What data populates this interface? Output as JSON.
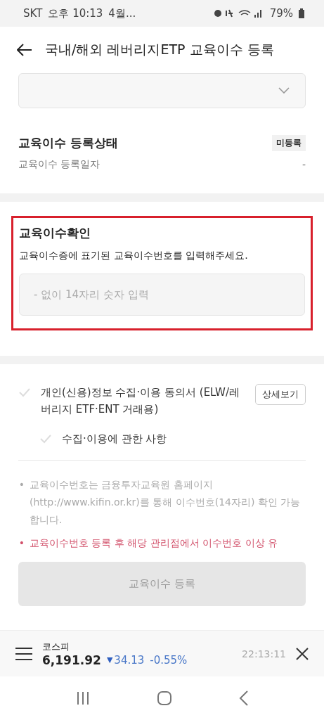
{
  "status_bar": {
    "carrier": "SKT",
    "time": "오후 10:13",
    "notification": "4월...",
    "battery": "79%"
  },
  "header": {
    "title": "국내/해외 레버리지ETP 교육이수 등록"
  },
  "account_select": {
    "expanded": false
  },
  "registration": {
    "title": "교육이수 등록상태",
    "badge": "미등록",
    "date_label": "교육이수 등록일자",
    "date_value": "-"
  },
  "confirm": {
    "highlighted": true,
    "title": "교육이수확인",
    "description": "교육이수증에 표기된 교육이수번호를 입력해주세요.",
    "placeholder": "- 없이 14자리 숫자 입력"
  },
  "consents": [
    {
      "label": "개인(신용)정보 수집·이용 동의서 (ELW/레버리지 ETF·ENT 거래용)",
      "checked": false,
      "button": "상세보기"
    },
    {
      "label": "수집·이용에 관한 사항",
      "checked": false
    }
  ],
  "notes": [
    {
      "text": "교육이수번호는 금융투자교육원 홈페이지(http://www.kifin.or.kr)를 통해 이수번호(14자리) 확인 가능합니다.",
      "kind": "info",
      "bullet": "•"
    },
    {
      "text": "교육이수번호 등록 후 해당 관리점에서 이수번호 이상 유",
      "kind": "warning",
      "bullet": "•"
    }
  ],
  "submit": {
    "label": "교육이수 등록",
    "disabled": true
  },
  "ticker": {
    "name": "코스피",
    "value": "6,191.92",
    "arrow": "▼",
    "change": "34.13",
    "rate": "-0.55%",
    "time": "22:13:11"
  }
}
